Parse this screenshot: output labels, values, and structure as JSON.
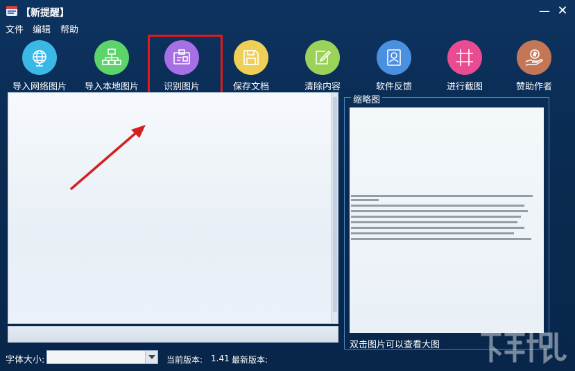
{
  "window": {
    "title": "【新提醒】",
    "minimize_glyph": "—",
    "close_glyph": "✕"
  },
  "menu": {
    "items": [
      {
        "label": "文件"
      },
      {
        "label": "编辑"
      },
      {
        "label": "帮助"
      }
    ]
  },
  "toolbar": {
    "items": [
      {
        "label": "导入网络图片",
        "icon": "globe-icon",
        "color": "#3ab8e6"
      },
      {
        "label": "导入本地图片",
        "icon": "network-icon",
        "color": "#5dd46a"
      },
      {
        "label": "识别图片",
        "icon": "id-card-icon",
        "color": "#a66fe3"
      },
      {
        "label": "保存文档",
        "icon": "floppy-disk-icon",
        "color": "#f0cf56"
      },
      {
        "label": "清除内容",
        "icon": "edit-icon",
        "color": "#9bd35a"
      },
      {
        "label": "软件反馈",
        "icon": "portrait-icon",
        "color": "#4a8fe0"
      },
      {
        "label": "进行截图",
        "icon": "crop-icon",
        "color": "#e94c90"
      },
      {
        "label": "赞助作者",
        "icon": "money-hand-icon",
        "color": "#c47757"
      }
    ]
  },
  "thumbnail": {
    "title": "缩略图",
    "caption": "双击图片可以查看大图"
  },
  "footer": {
    "font_size_label": "字体大小:",
    "font_size_value": "",
    "version_label": "当前版本:",
    "version_value": "1.41",
    "latest_label": "最新版本:"
  },
  "colors": {
    "background": "#0a2b52",
    "highlight": "#e21a1a",
    "panel_border": "#4d86c0"
  }
}
